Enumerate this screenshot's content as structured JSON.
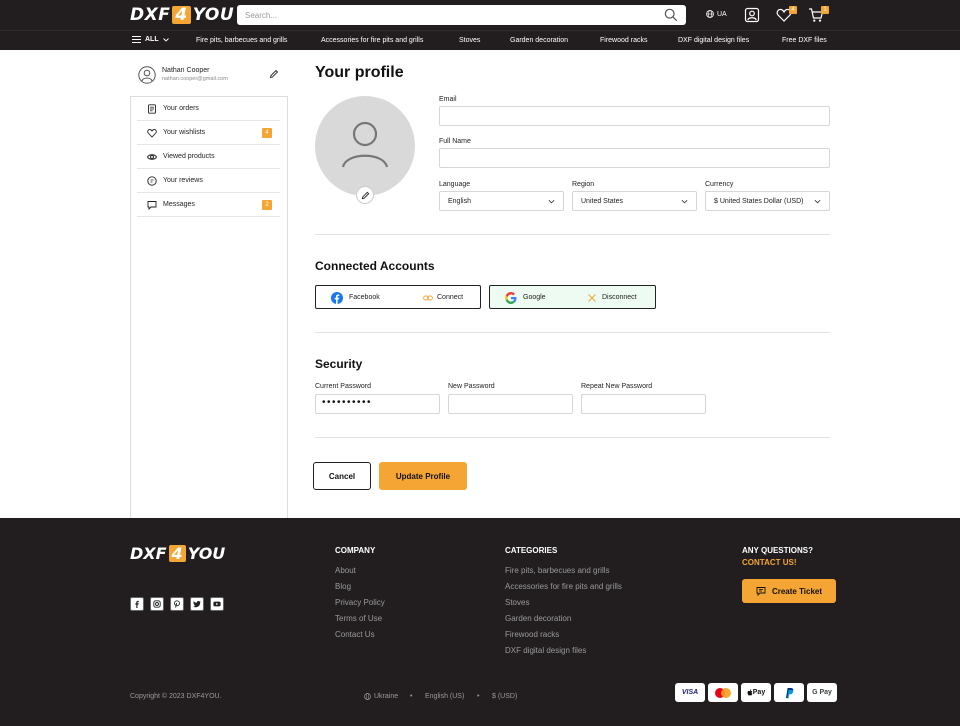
{
  "header": {
    "logo_left": "DXF",
    "logo_mid": "4",
    "logo_right": "YOU",
    "search_placeholder": "Search...",
    "lang": "UA",
    "wishlist_count": "4",
    "cart_count": "1"
  },
  "nav": {
    "all_label": "ALL",
    "items": [
      "Fire pits, barbecues and grills",
      "Accessories for fire pits and grills",
      "Stoves",
      "Garden decoration",
      "Firewood racks",
      "DXF digital design files",
      "Free DXF files"
    ]
  },
  "sidebar": {
    "user_name": "Nathan Cooper",
    "user_email": "nathan.cooper@gmail.com",
    "items": [
      {
        "label": "Your orders",
        "icon": "orders-icon",
        "badge": ""
      },
      {
        "label": "Your wishlists",
        "icon": "heart-icon",
        "badge": "4"
      },
      {
        "label": "Viewed products",
        "icon": "eye-icon",
        "badge": ""
      },
      {
        "label": "Your reviews",
        "icon": "review-icon",
        "badge": ""
      },
      {
        "label": "Messages",
        "icon": "message-icon",
        "badge": "2"
      }
    ]
  },
  "profile": {
    "title": "Your profile",
    "email_label": "Email",
    "email_value": "",
    "fullname_label": "Full Name",
    "fullname_value": "",
    "language_label": "Language",
    "language_value": "English",
    "region_label": "Region",
    "region_value": "United States",
    "currency_label": "Currency",
    "currency_value": "$ United States Dollar (USD)"
  },
  "connected": {
    "title": "Connected Accounts",
    "facebook_name": "Facebook",
    "facebook_action": "Connect",
    "google_name": "Google",
    "google_action": "Disconnect"
  },
  "security": {
    "title": "Security",
    "current_label": "Current Password",
    "current_value": "••••••••••",
    "new_label": "New Password",
    "repeat_label": "Repeat New Password"
  },
  "actions": {
    "cancel": "Cancel",
    "update": "Update Profile"
  },
  "footer": {
    "company_title": "COMPANY",
    "company_links": [
      "About",
      "Blog",
      "Privacy Policy",
      "Terms of Use",
      "Contact Us"
    ],
    "categories_title": "CATEGORIES",
    "category_links": [
      "Fire pits, barbecues and grills",
      "Accessories for fire pits and grills",
      "Stoves",
      "Garden decoration",
      "Firewood racks",
      "DXF digital design files"
    ],
    "questions": "ANY QUESTIONS?",
    "contact": "CONTACT US!",
    "ticket": "Create Ticket",
    "copyright": "Copyright © 2023 DXF4YOU.",
    "country": "Ukraine",
    "language": "English (US)",
    "currency": "$ (USD)",
    "payments": [
      "VISA",
      "Mastercard",
      "Apple Pay",
      "PayPal",
      "G Pay"
    ]
  },
  "colors": {
    "accent": "#f4a533",
    "dark": "#221e1f"
  }
}
